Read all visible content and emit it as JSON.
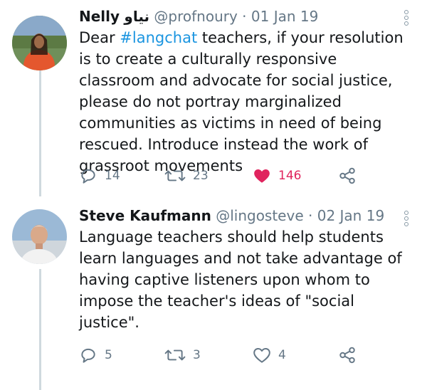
{
  "tweets": [
    {
      "name": "Nelly",
      "name_arabic": "نياو",
      "handle": "@profnoury",
      "separator": "·",
      "date": "01 Jan 19",
      "text_before": "Dear ",
      "hashtag": "#langchat",
      "text_after": " teachers, if your resolution is to create a culturally responsive classroom and advocate for social justice, please do not portray marginalized communities as victims in need of being rescued. Introduce instead the work of grassroot movements",
      "replies": "14",
      "retweets": "23",
      "likes": "146",
      "liked": true
    },
    {
      "name": "Steve Kaufmann",
      "handle": "@lingosteve",
      "separator": "·",
      "date": "02 Jan 19",
      "text": "Language teachers should help students learn languages and not take advantage of having captive listeners upon whom to impose the teacher's ideas of \"social justice\".",
      "replies": "5",
      "retweets": "3",
      "likes": "4",
      "liked": false
    }
  ],
  "icons": {
    "reply": "reply-icon",
    "retweet": "retweet-icon",
    "like": "heart-icon",
    "share": "share-icon",
    "more": "more-vertical-icon"
  },
  "colors": {
    "like_active": "#e0245e",
    "hashtag": "#1b95e0",
    "muted": "#657786",
    "thread_line": "#cfd9de"
  }
}
